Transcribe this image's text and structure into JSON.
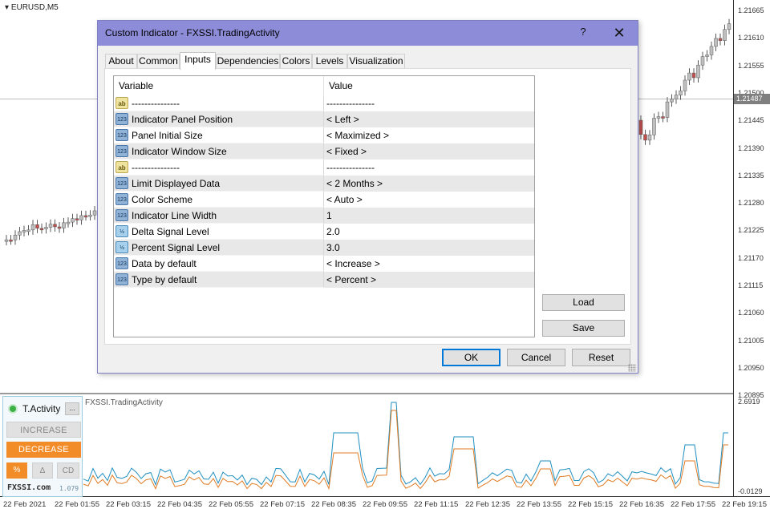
{
  "chart": {
    "symbol": "EURUSD,M5",
    "current_price": "1.21487",
    "price_axis": [
      "1.21665",
      "1.21610",
      "1.21555",
      "1.21500",
      "1.21445",
      "1.21390",
      "1.21335",
      "1.21280",
      "1.21225",
      "1.21170",
      "1.21115",
      "1.21060",
      "1.21005",
      "1.20950",
      "1.20895"
    ],
    "time_axis": [
      "22 Feb 2021",
      "22 Feb 01:55",
      "22 Feb 03:15",
      "22 Feb 04:35",
      "22 Feb 05:55",
      "22 Feb 07:15",
      "22 Feb 08:35",
      "22 Feb 09:55",
      "22 Feb 11:15",
      "22 Feb 12:35",
      "22 Feb 13:55",
      "22 Feb 15:15",
      "22 Feb 16:35",
      "22 Feb 17:55",
      "22 Feb 19:15"
    ],
    "indicator_title": "FXSSI.TradingActivity",
    "sub_max": "2.6919",
    "sub_min": "-0.0129",
    "colors": {
      "up": "#bfbfbf",
      "down": "#c0504d",
      "wick": "#5a5a5a",
      "line_blue": "#1f8fc0",
      "line_orange": "#e07b24"
    }
  },
  "indicator_panel": {
    "title": "T.Activity",
    "more_label": "...",
    "increase_label": "INCREASE",
    "decrease_label": "DECREASE",
    "percent_label": "%",
    "delta_label": "Δ",
    "cd_label": "CD",
    "brand": "FXSSI.com",
    "version": "1.079"
  },
  "dialog": {
    "title": "Custom Indicator - FXSSI.TradingActivity",
    "help_label": "?",
    "close_label": "✕",
    "tabs": [
      {
        "label": "About"
      },
      {
        "label": "Common"
      },
      {
        "label": "Inputs",
        "active": true
      },
      {
        "label": "Dependencies"
      },
      {
        "label": "Colors"
      },
      {
        "label": "Levels"
      },
      {
        "label": "Visualization"
      }
    ],
    "table": {
      "col_variable": "Variable",
      "col_value": "Value",
      "rows": [
        {
          "icon": "ab",
          "icon_text": "ab",
          "variable": "---------------",
          "value": "---------------"
        },
        {
          "icon": "n123",
          "icon_text": "123",
          "variable": "Indicator Panel Position",
          "value": "< Left >"
        },
        {
          "icon": "n123",
          "icon_text": "123",
          "variable": "Panel Initial Size",
          "value": "< Maximized >"
        },
        {
          "icon": "n123",
          "icon_text": "123",
          "variable": "Indicator Window Size",
          "value": "< Fixed >"
        },
        {
          "icon": "ab",
          "icon_text": "ab",
          "variable": "---------------",
          "value": "---------------"
        },
        {
          "icon": "n123",
          "icon_text": "123",
          "variable": "Limit Displayed Data",
          "value": "< 2 Months >"
        },
        {
          "icon": "n123",
          "icon_text": "123",
          "variable": "Color Scheme",
          "value": "< Auto >"
        },
        {
          "icon": "n123",
          "icon_text": "123",
          "variable": "Indicator Line Width",
          "value": "1"
        },
        {
          "icon": "half",
          "icon_text": "½",
          "variable": "Delta Signal Level",
          "value": "2.0"
        },
        {
          "icon": "half",
          "icon_text": "½",
          "variable": "Percent Signal Level",
          "value": "3.0"
        },
        {
          "icon": "n123",
          "icon_text": "123",
          "variable": "Data by default",
          "value": "< Increase >"
        },
        {
          "icon": "n123",
          "icon_text": "123",
          "variable": "Type by default",
          "value": "< Percent >"
        }
      ]
    },
    "load_label": "Load",
    "save_label": "Save",
    "ok_label": "OK",
    "cancel_label": "Cancel",
    "reset_label": "Reset"
  }
}
